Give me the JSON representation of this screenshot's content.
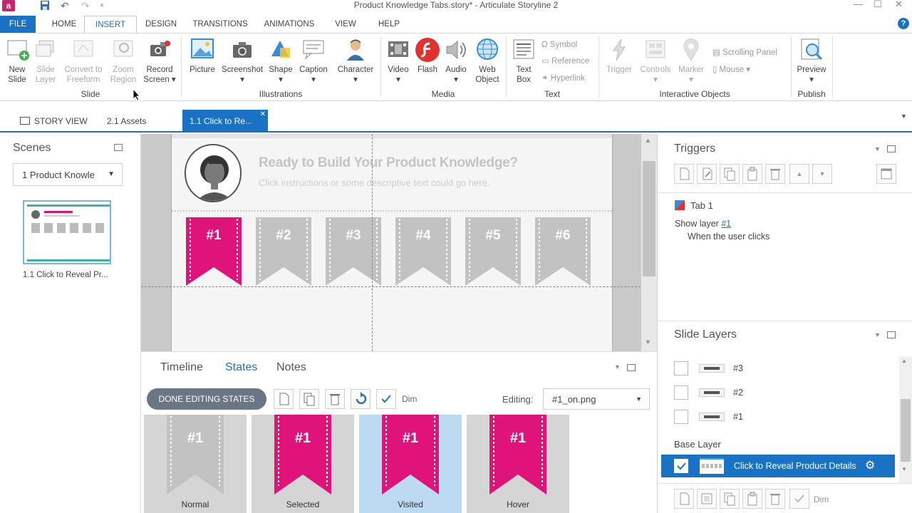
{
  "app": {
    "logo_letter": "a",
    "window_title": "Product Knowledge Tabs.story* - Articulate Storyline 2",
    "undo_symbol": "↶",
    "redo_symbol": "↷"
  },
  "menu": {
    "file": "FILE",
    "tabs": [
      "HOME",
      "INSERT",
      "DESIGN",
      "TRANSITIONS",
      "ANIMATIONS",
      "VIEW",
      "HELP"
    ],
    "help_symbol": "?"
  },
  "ribbon": {
    "slide_group": {
      "label": "Slide",
      "buttons": [
        {
          "line1": "New",
          "line2": "Slide"
        },
        {
          "line1": "Slide",
          "line2": "Layer"
        },
        {
          "line1": "Convert to",
          "line2": "Freeform"
        },
        {
          "line1": "Zoom",
          "line2": "Region"
        },
        {
          "line1": "Record",
          "line2": "Screen ▾"
        }
      ]
    },
    "illustrations_group": {
      "label": "Illustrations",
      "buttons": [
        "Picture",
        "Screenshot",
        "Shape",
        "Caption",
        "Character"
      ]
    },
    "media_group": {
      "label": "Media",
      "buttons": [
        {
          "line1": "Video",
          "line2": ""
        },
        {
          "line1": "Flash",
          "line2": ""
        },
        {
          "line1": "Audio",
          "line2": ""
        },
        {
          "line1": "Web",
          "line2": "Object"
        }
      ]
    },
    "text_group": {
      "label": "Text",
      "textbox_line1": "Text",
      "textbox_line2": "Box",
      "symbol": "Symbol",
      "reference": "Reference",
      "hyperlink": "Hyperlink"
    },
    "interactive_group": {
      "label": "Interactive Objects",
      "trigger": "Trigger",
      "controls": "Controls",
      "marker": "Marker",
      "scrolling_panel": "Scrolling Panel",
      "mouse": "Mouse"
    },
    "publish_group": {
      "label": "Publish",
      "preview": "Preview"
    }
  },
  "doc_tabs": {
    "story_view": "STORY VIEW",
    "assets": "2.1 Assets",
    "active": "1.1 Click to Re..."
  },
  "scenes": {
    "title": "Scenes",
    "dropdown_value": "1 Product Knowle",
    "thumb_label": "1.1 Click to Reveal Pr..."
  },
  "slide": {
    "heading": "Ready to Build Your Product Knowledge?",
    "subtext": "Click instructions or some descriptive text could go here.",
    "tabs": [
      "#1",
      "#2",
      "#3",
      "#4",
      "#5",
      "#6"
    ]
  },
  "states_panel": {
    "tabs": [
      "Timeline",
      "States",
      "Notes"
    ],
    "done_button": "DONE EDITING STATES",
    "dim_label": "Dim",
    "editing_label": "Editing:",
    "editing_value": "#1_on.png",
    "states": [
      {
        "name": "Normal",
        "label": "#1",
        "color": "#c2c2c2"
      },
      {
        "name": "Selected",
        "label": "#1",
        "color": "#e0137a"
      },
      {
        "name": "Visited",
        "label": "#1",
        "color": "#e0137a"
      },
      {
        "name": "Hover",
        "label": "#1",
        "color": "#e0137a"
      }
    ]
  },
  "triggers": {
    "title": "Triggers",
    "item_name": "Tab 1",
    "action_prefix": "Show layer",
    "action_target": "#1",
    "condition": "When the user clicks"
  },
  "layers": {
    "title": "Slide Layers",
    "items": [
      "#3",
      "#2",
      "#1"
    ],
    "base_label": "Base Layer",
    "base_name": "Click to Reveal Product Details",
    "dim_label": "Dim"
  },
  "colors": {
    "accent": "#1a72c4",
    "magenta": "#e0137a",
    "tab_gray": "#c2c2c2"
  }
}
